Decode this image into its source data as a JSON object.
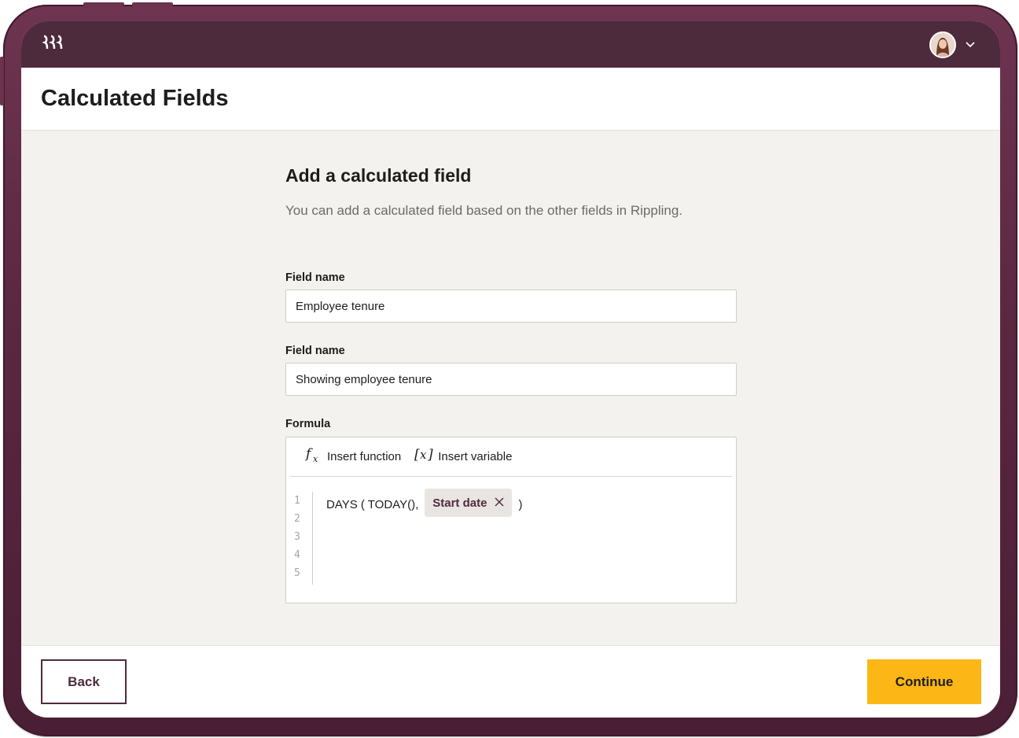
{
  "app": {
    "logo_text": "⦚⦚⦚",
    "logo_icon": "rippling-logo-icon",
    "avatar_icon": "user-avatar-icon",
    "chevron": "⌄"
  },
  "header": {
    "title": "Calculated Fields"
  },
  "form": {
    "title": "Add a calculated field",
    "description": "You can add a calculated field based on the other fields in Rippling.",
    "field1_label": "Field name",
    "field1_value": "Employee tenure",
    "field2_label": "Field name",
    "field2_value": "Showing employee tenure",
    "formula_label": "Formula"
  },
  "formula": {
    "insert_function_icon": "fx",
    "insert_function_label": "Insert function",
    "insert_variable_icon": "[x]",
    "insert_variable_label": "Insert variable",
    "line_numbers": [
      "1",
      "2",
      "3",
      "4",
      "5"
    ],
    "code_prefix": "DAYS ( TODAY(),",
    "chip_label": "Start date",
    "chip_close": "✕",
    "code_suffix": ")"
  },
  "footer": {
    "back_label": "Back",
    "continue_label": "Continue"
  },
  "colors": {
    "frame": "#5a2740",
    "topbar": "#4e2b3c",
    "accent": "#fcb616",
    "background": "#f3f2ef"
  }
}
